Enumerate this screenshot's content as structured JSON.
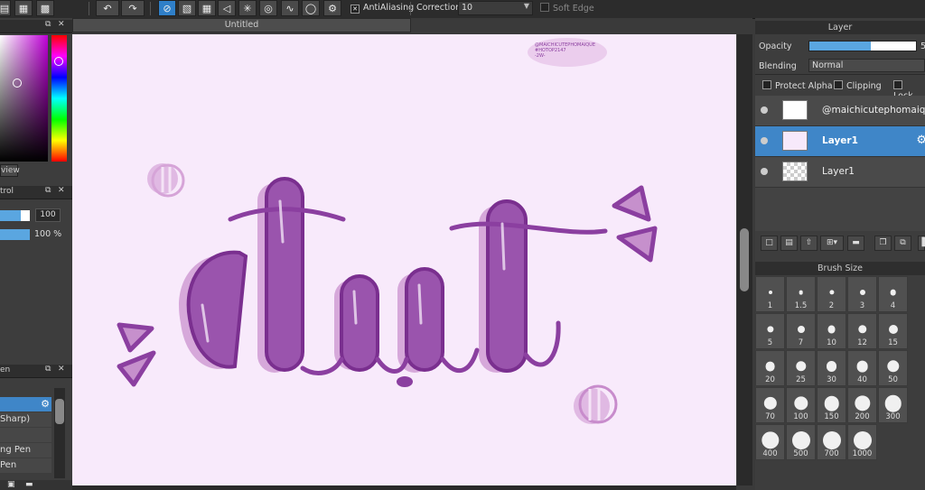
{
  "toolbar": {
    "antialiasing_label": "AntiAliasing",
    "antialiasing_checked": "✕",
    "correction_label": "Correction",
    "correction_value": "10",
    "soft_edge_label": "Soft Edge"
  },
  "left_panel": {
    "view_button": "view",
    "control_panel_title": "trol",
    "control_value": "100",
    "control_percent": "100 %",
    "brush_panel_title": "en",
    "brush_list": [
      "",
      "Sharp)",
      "",
      "ng Pen",
      "Pen"
    ]
  },
  "document": {
    "tab_title": "Untitled",
    "watermark": [
      "@MAICHICUTEPHOMAIQUE",
      "#HOTOP2147",
      "-2W-"
    ]
  },
  "layer_panel": {
    "title": "Layer",
    "opacity_label": "Opacity",
    "opacity_value_partial": "5",
    "opacity_fraction": 0.58,
    "blending_label": "Blending",
    "blending_value": "Normal",
    "protect_alpha_label": "Protect Alpha",
    "clipping_label": "Clipping",
    "lock_label": "Lock",
    "layers": [
      {
        "name": "@maichicutephomaique",
        "selected": false
      },
      {
        "name": "Layer1",
        "selected": true
      },
      {
        "name": "Layer1",
        "selected": false
      }
    ]
  },
  "brush_size_panel": {
    "title": "Brush Size",
    "sizes": [
      "1",
      "1.5",
      "2",
      "3",
      "4",
      "5",
      "7",
      "10",
      "12",
      "15",
      "20",
      "25",
      "30",
      "40",
      "50",
      "70",
      "100",
      "150",
      "200",
      "300",
      "400",
      "500",
      "700",
      "1000"
    ]
  },
  "colors": {
    "accent": "#2f7fc8",
    "canvas_bg": "#f8eafb",
    "ink": "#8b3fa0"
  }
}
